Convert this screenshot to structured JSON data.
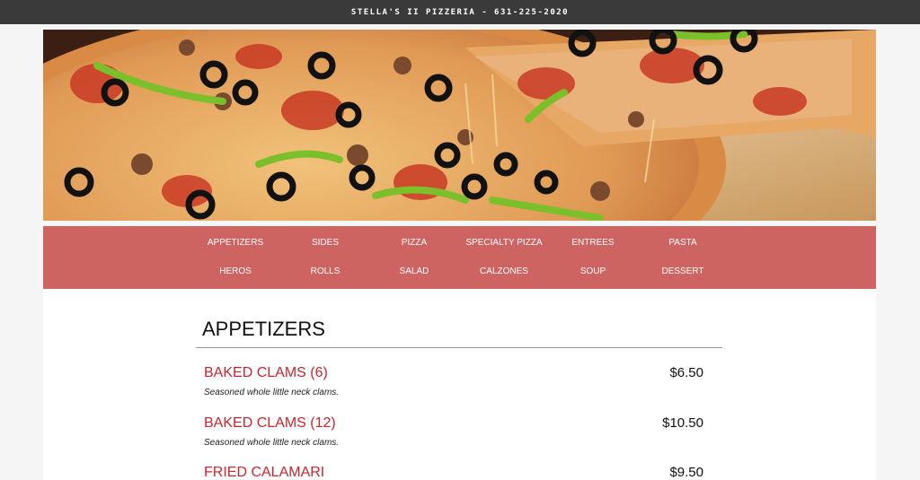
{
  "header": {
    "title": "STELLA'S II PIZZERIA - 631-225-2020"
  },
  "colors": {
    "topbar": "#3a3a3a",
    "nav": "#cd6462",
    "item_name": "#c8262e"
  },
  "nav": {
    "row1": [
      "APPETIZERS",
      "SIDES",
      "PIZZA",
      "SPECIALTY PIZZA",
      "ENTREES",
      "PASTA"
    ],
    "row2": [
      "HEROS",
      "ROLLS",
      "SALAD",
      "CALZONES",
      "SOUP",
      "DESSERT"
    ]
  },
  "section": {
    "title": "APPETIZERS",
    "items": [
      {
        "name": "BAKED CLAMS (6)",
        "price": "$6.50",
        "desc": "Seasoned whole little neck clams."
      },
      {
        "name": "BAKED CLAMS (12)",
        "price": "$10.50",
        "desc": "Seasoned whole little neck clams."
      },
      {
        "name": "FRIED CALAMARI",
        "price": "$9.50",
        "desc": ""
      }
    ]
  }
}
